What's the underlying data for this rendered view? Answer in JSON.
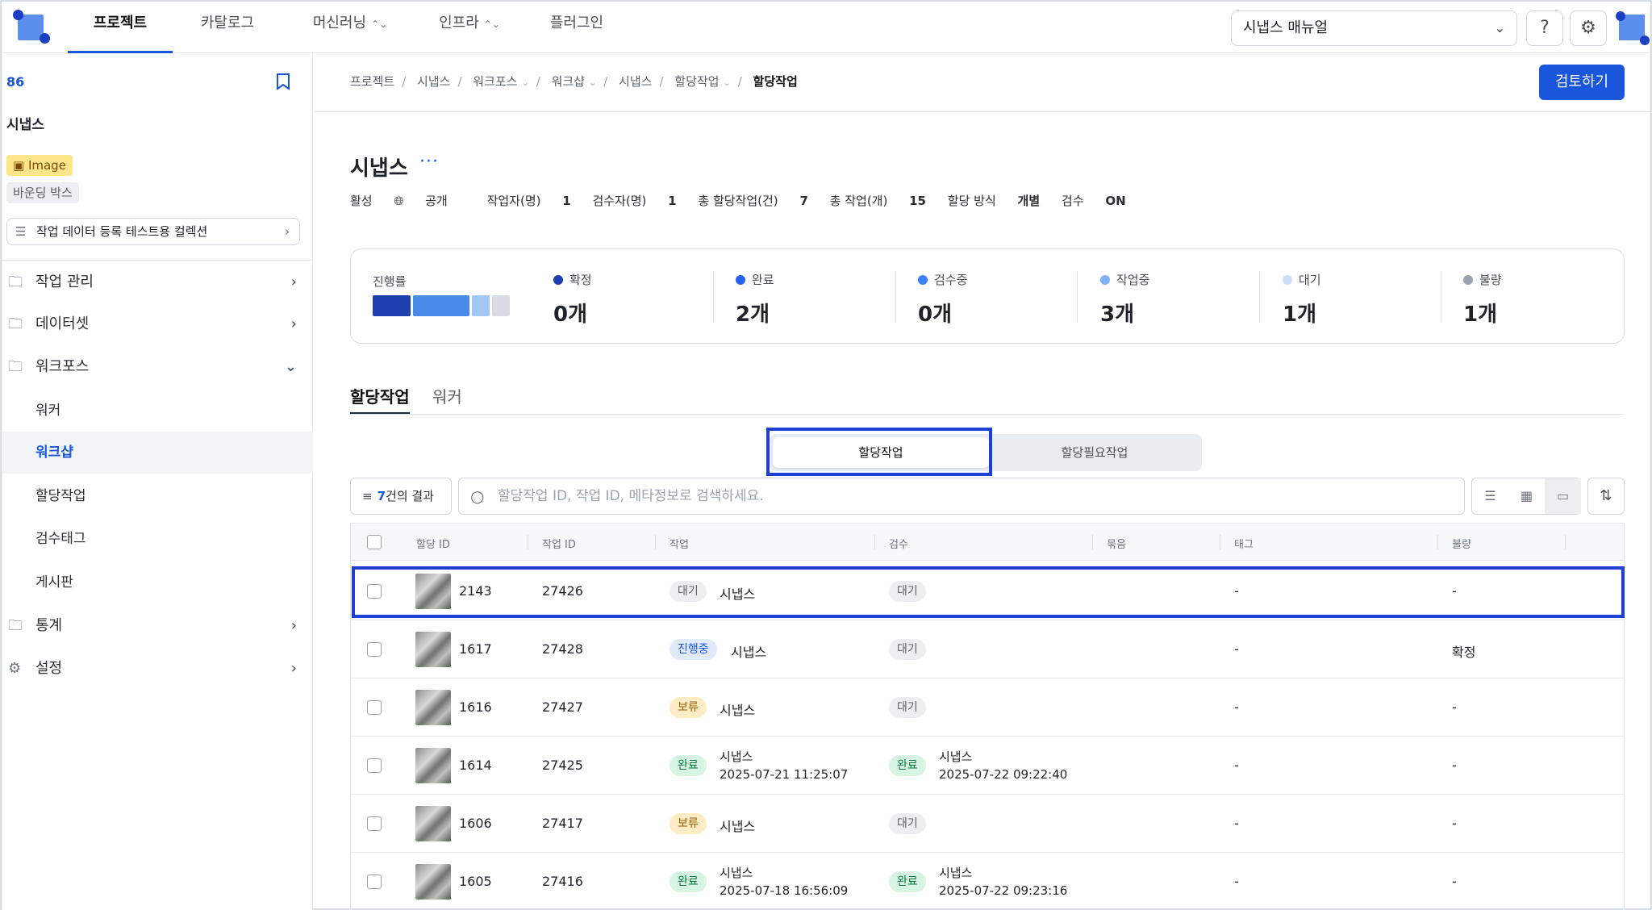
{
  "nav": {
    "tabs": [
      {
        "label": "프로젝트"
      },
      {
        "label": "카탈로그"
      },
      {
        "label": "머신러닝"
      },
      {
        "label": "인프라"
      },
      {
        "label": "플러그인"
      }
    ],
    "manual_select": "시냅스 매뉴얼"
  },
  "sidebar": {
    "project_id": "86",
    "project_name": "시냅스",
    "badge_type": "Image",
    "badge_annotation": "바운딩 박스",
    "collection": "작업 데이터 등록 테스트용 컬렉션",
    "items": [
      {
        "label": "작업 관리"
      },
      {
        "label": "데이터셋"
      },
      {
        "label": "워크포스"
      },
      {
        "label": "통계"
      },
      {
        "label": "설정"
      }
    ],
    "sub_items": [
      {
        "label": "워커"
      },
      {
        "label": "워크샵"
      },
      {
        "label": "할당작업"
      },
      {
        "label": "검수태그"
      },
      {
        "label": "게시판"
      }
    ]
  },
  "breadcrumb": [
    "프로젝트",
    "시냅스",
    "워크포스",
    "워크샵",
    "시냅스",
    "할당작업",
    "할당작업"
  ],
  "review_button": "검토하기",
  "title": "시냅스",
  "meta": {
    "status": "활성",
    "visibility": "공개",
    "workers_label": "작업자(명)",
    "workers": "1",
    "reviewers_label": "검수자(명)",
    "reviewers": "1",
    "assignments_label": "총 할당작업(건)",
    "assignments": "7",
    "tasks_label": "총 작업(개)",
    "tasks": "15",
    "method_label": "할당 방식",
    "method": "개별",
    "review_label": "검수",
    "review": "ON"
  },
  "progress": {
    "label": "진행률",
    "stats": [
      {
        "label": "확정",
        "value": "0개",
        "color": "#1e40af"
      },
      {
        "label": "완료",
        "value": "2개",
        "color": "#2563eb"
      },
      {
        "label": "검수중",
        "value": "0개",
        "color": "#3b82f6"
      },
      {
        "label": "작업중",
        "value": "3개",
        "color": "#7fb2f5"
      },
      {
        "label": "대기",
        "value": "1개",
        "color": "#c9def9"
      },
      {
        "label": "불량",
        "value": "1개",
        "color": "#9ca3af"
      }
    ]
  },
  "subtabs": [
    "할당작업",
    "워커"
  ],
  "segments": [
    "할당작업",
    "할당필요작업"
  ],
  "filter": {
    "count": "7",
    "suffix": "건의 결과"
  },
  "search_placeholder": "할당작업 ID, 작업 ID, 메타정보로 검색하세요.",
  "table": {
    "headers": [
      "할당 ID",
      "작업 ID",
      "작업",
      "검수",
      "묶음",
      "태그",
      "불량"
    ],
    "rows": [
      {
        "assign_id": "2143",
        "task_id": "27426",
        "work_status": "대기",
        "work_status_kind": "wait",
        "work_user": "시냅스",
        "work_time": "",
        "review_status": "대기",
        "review_status_kind": "wait",
        "review_user": "",
        "review_time": "",
        "tag": "-",
        "defect": "-"
      },
      {
        "assign_id": "1617",
        "task_id": "27428",
        "work_status": "진행중",
        "work_status_kind": "prog",
        "work_user": "시냅스",
        "work_time": "",
        "review_status": "대기",
        "review_status_kind": "wait",
        "review_user": "",
        "review_time": "",
        "tag": "-",
        "defect": "확정"
      },
      {
        "assign_id": "1616",
        "task_id": "27427",
        "work_status": "보류",
        "work_status_kind": "hold",
        "work_user": "시냅스",
        "work_time": "",
        "review_status": "대기",
        "review_status_kind": "wait",
        "review_user": "",
        "review_time": "",
        "tag": "-",
        "defect": "-"
      },
      {
        "assign_id": "1614",
        "task_id": "27425",
        "work_status": "완료",
        "work_status_kind": "done",
        "work_user": "시냅스",
        "work_time": "2025-07-21 11:25:07",
        "review_status": "완료",
        "review_status_kind": "done",
        "review_user": "시냅스",
        "review_time": "2025-07-22 09:22:40",
        "tag": "-",
        "defect": "-"
      },
      {
        "assign_id": "1606",
        "task_id": "27417",
        "work_status": "보류",
        "work_status_kind": "hold",
        "work_user": "시냅스",
        "work_time": "",
        "review_status": "대기",
        "review_status_kind": "wait",
        "review_user": "",
        "review_time": "",
        "tag": "-",
        "defect": "-"
      },
      {
        "assign_id": "1605",
        "task_id": "27416",
        "work_status": "완료",
        "work_status_kind": "done",
        "work_user": "시냅스",
        "work_time": "2025-07-18 16:56:09",
        "review_status": "완료",
        "review_status_kind": "done",
        "review_user": "시냅스",
        "review_time": "2025-07-22 09:23:16",
        "tag": "-",
        "defect": "-"
      }
    ]
  }
}
